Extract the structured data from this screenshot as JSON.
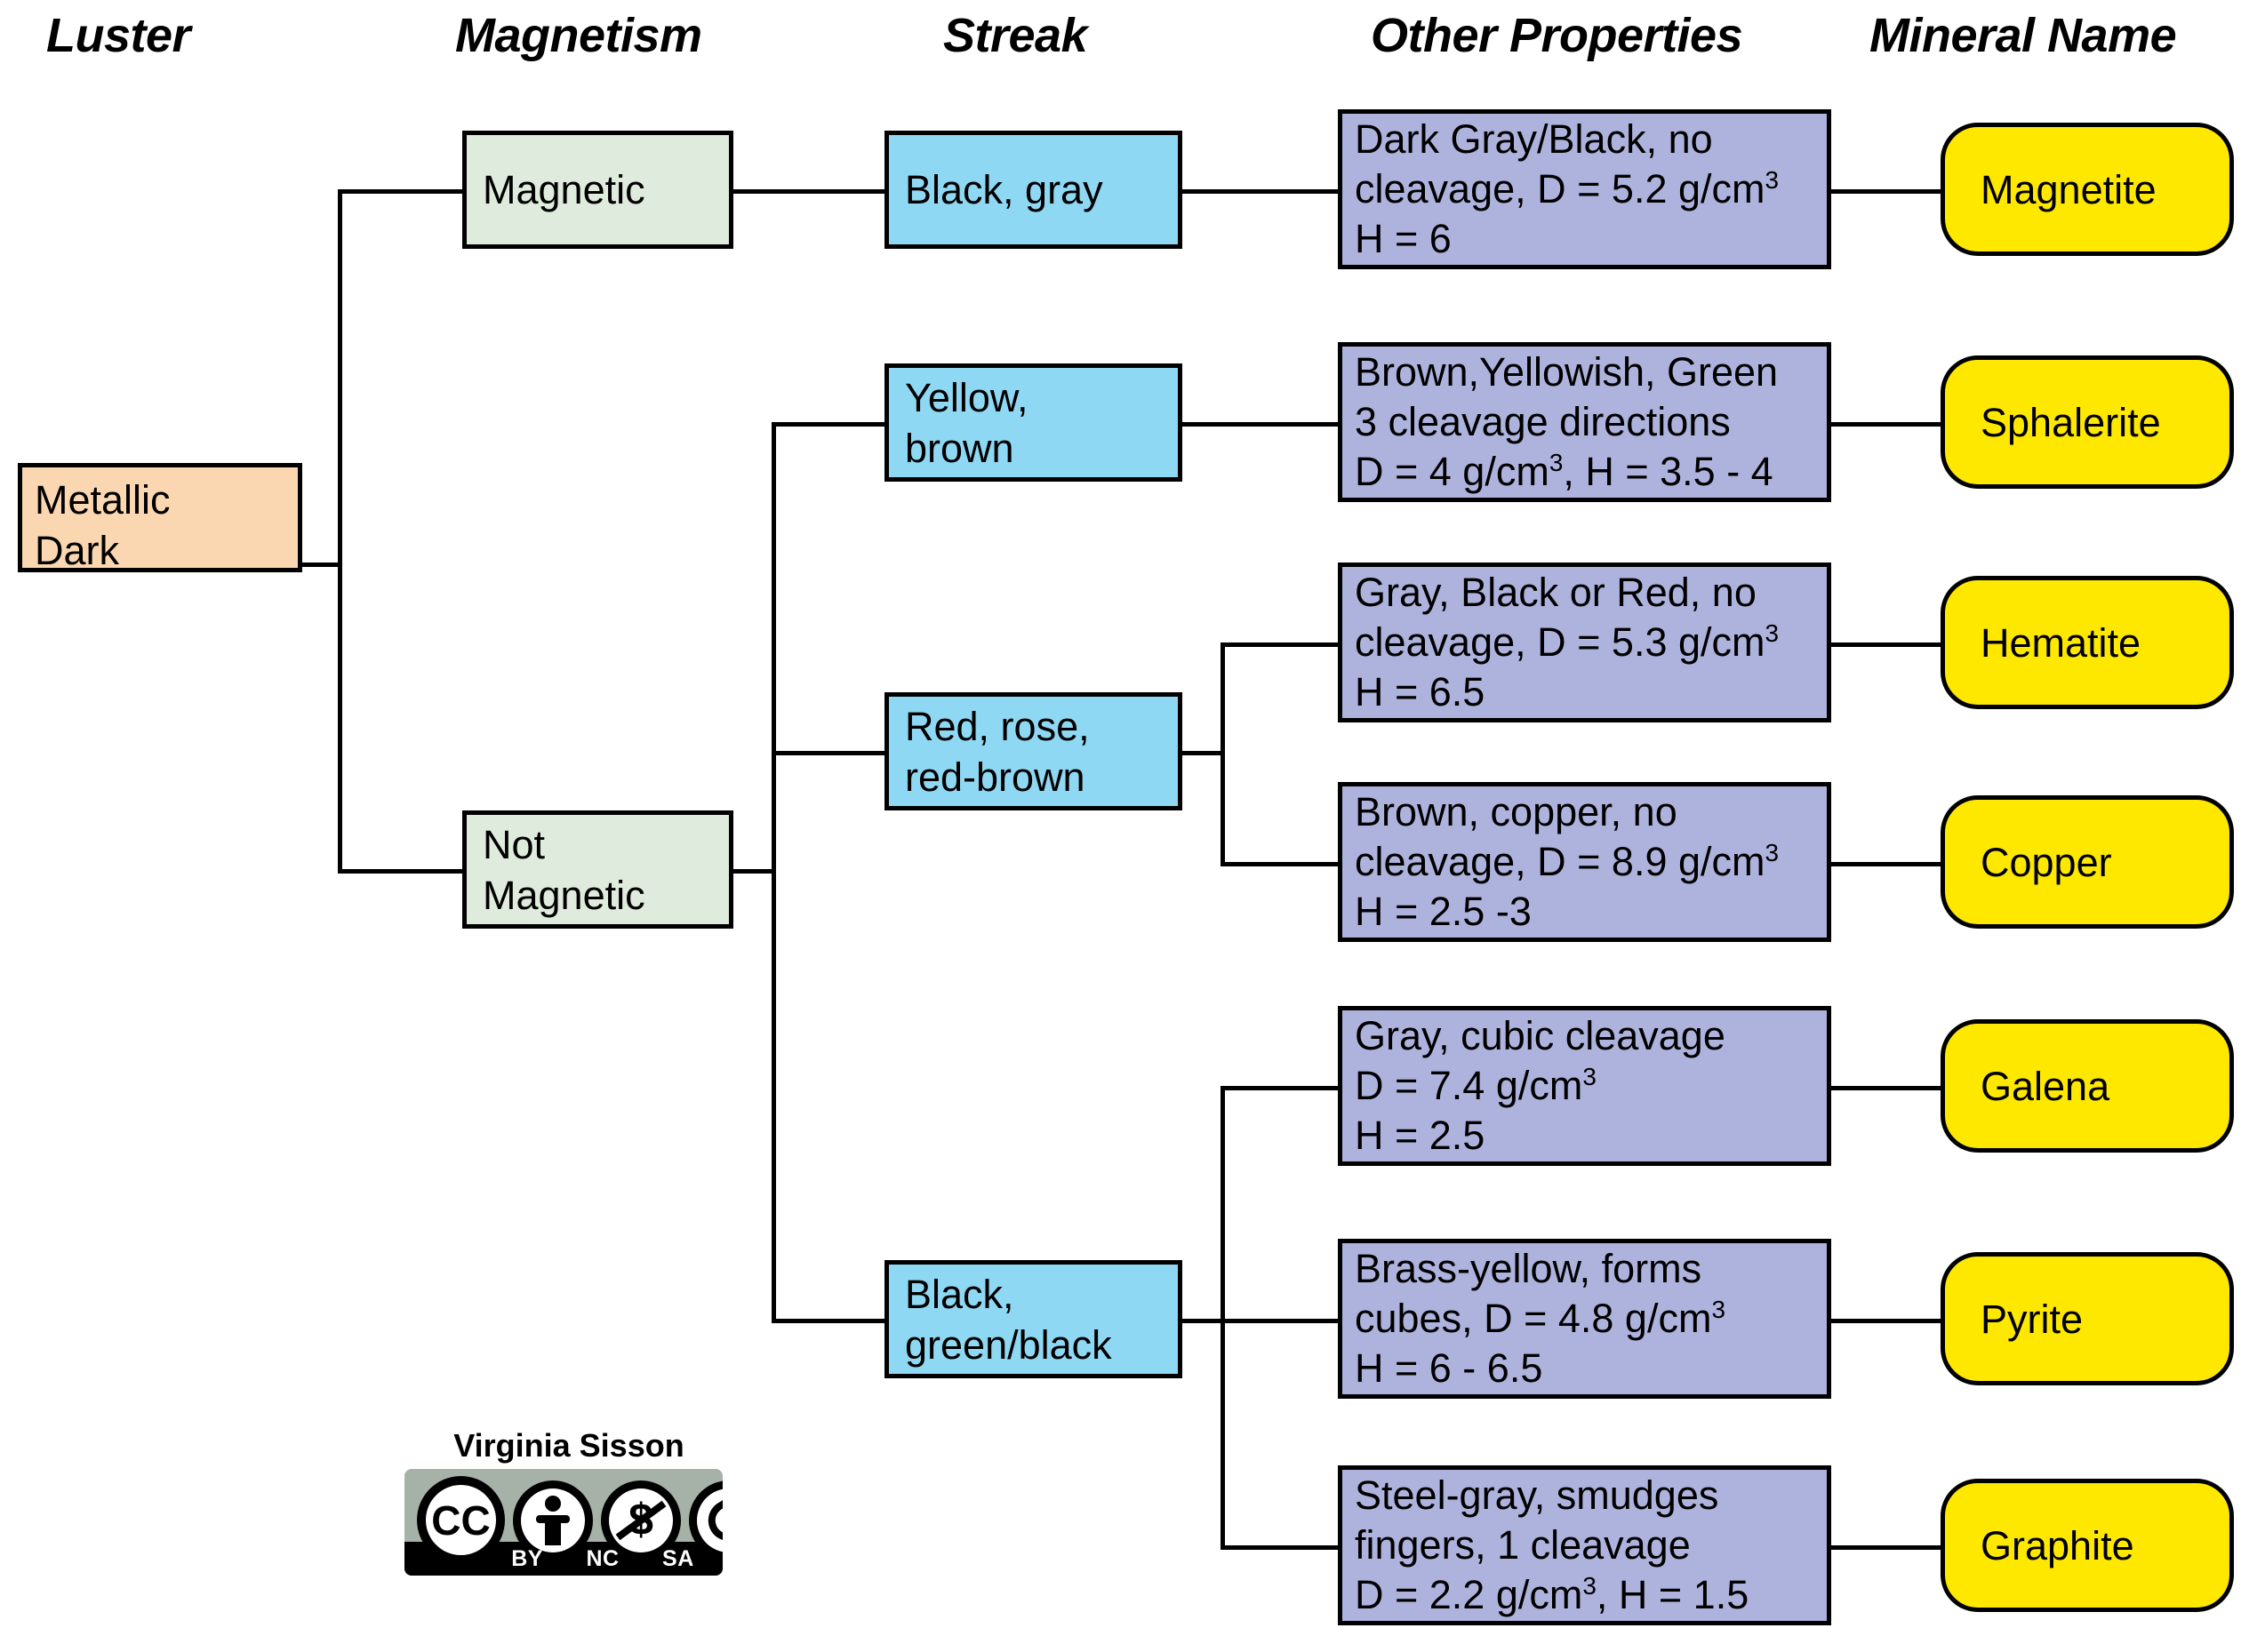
{
  "headers": [
    {
      "label": "Luster"
    },
    {
      "label": "Magnetism"
    },
    {
      "label": "Streak"
    },
    {
      "label": "Other Properties"
    },
    {
      "label": "Mineral Name"
    }
  ],
  "luster": {
    "line1": "Metallic",
    "line2": "Dark"
  },
  "magnetism": [
    {
      "line1": "Magnetic",
      "line2": ""
    },
    {
      "line1": "Not",
      "line2": "Magnetic"
    }
  ],
  "streak": [
    {
      "line1": "Black, gray",
      "line2": ""
    },
    {
      "line1": "Yellow,",
      "line2": "brown"
    },
    {
      "line1": "Red, rose,",
      "line2": "red-brown"
    },
    {
      "line1": "Black,",
      "line2": "green/black"
    }
  ],
  "properties": [
    {
      "line1": "Dark Gray/Black, no",
      "line2_pre": "cleavage, D = 5.2 g/cm",
      "line2_sup": "3",
      "line2_post": "",
      "line3_pre": "H = 6",
      "line3_sup": "",
      "line3_post": ""
    },
    {
      "line1": "Brown,Yellowish, Green",
      "line2_pre": "3 cleavage directions",
      "line2_sup": "",
      "line2_post": "",
      "line3_pre": "D = 4 g/cm",
      "line3_sup": "3",
      "line3_post": ", H = 3.5 - 4"
    },
    {
      "line1": "Gray, Black or Red, no",
      "line2_pre": "cleavage, D = 5.3 g/cm",
      "line2_sup": "3",
      "line2_post": "",
      "line3_pre": "H = 6.5",
      "line3_sup": "",
      "line3_post": ""
    },
    {
      "line1": "Brown, copper, no",
      "line2_pre": "cleavage, D = 8.9 g/cm",
      "line2_sup": "3",
      "line2_post": "",
      "line3_pre": "H = 2.5 -3",
      "line3_sup": "",
      "line3_post": ""
    },
    {
      "line1": "Gray, cubic cleavage",
      "line2_pre": "D = 7.4 g/cm",
      "line2_sup": "3",
      "line2_post": "",
      "line3_pre": "H = 2.5",
      "line3_sup": "",
      "line3_post": ""
    },
    {
      "line1": "Brass-yellow, forms",
      "line2_pre": "cubes, D = 4.8 g/cm",
      "line2_sup": "3",
      "line2_post": "",
      "line3_pre": "H = 6 - 6.5",
      "line3_sup": "",
      "line3_post": ""
    },
    {
      "line1": "Steel-gray, smudges",
      "line2_pre": "fingers, 1 cleavage",
      "line2_sup": "",
      "line2_post": "",
      "line3_pre": "D = 2.2 g/cm",
      "line3_sup": "3",
      "line3_post": ", H = 1.5"
    }
  ],
  "minerals": [
    {
      "name": "Magnetite"
    },
    {
      "name": "Sphalerite"
    },
    {
      "name": "Hematite"
    },
    {
      "name": "Copper"
    },
    {
      "name": "Galena"
    },
    {
      "name": "Pyrite"
    },
    {
      "name": "Graphite"
    }
  ],
  "license": {
    "author": "Virginia Sisson",
    "cc": "CC",
    "by": "BY",
    "nc": "NC",
    "sa": "SA"
  },
  "colors": {
    "luster_fill": "#fad7b0",
    "magnetism_fill": "#dfebdc",
    "streak_fill": "#8fd8f3",
    "properties_fill": "#aeb3dd",
    "mineral_fill": "#ffe800",
    "line": "#000000"
  }
}
